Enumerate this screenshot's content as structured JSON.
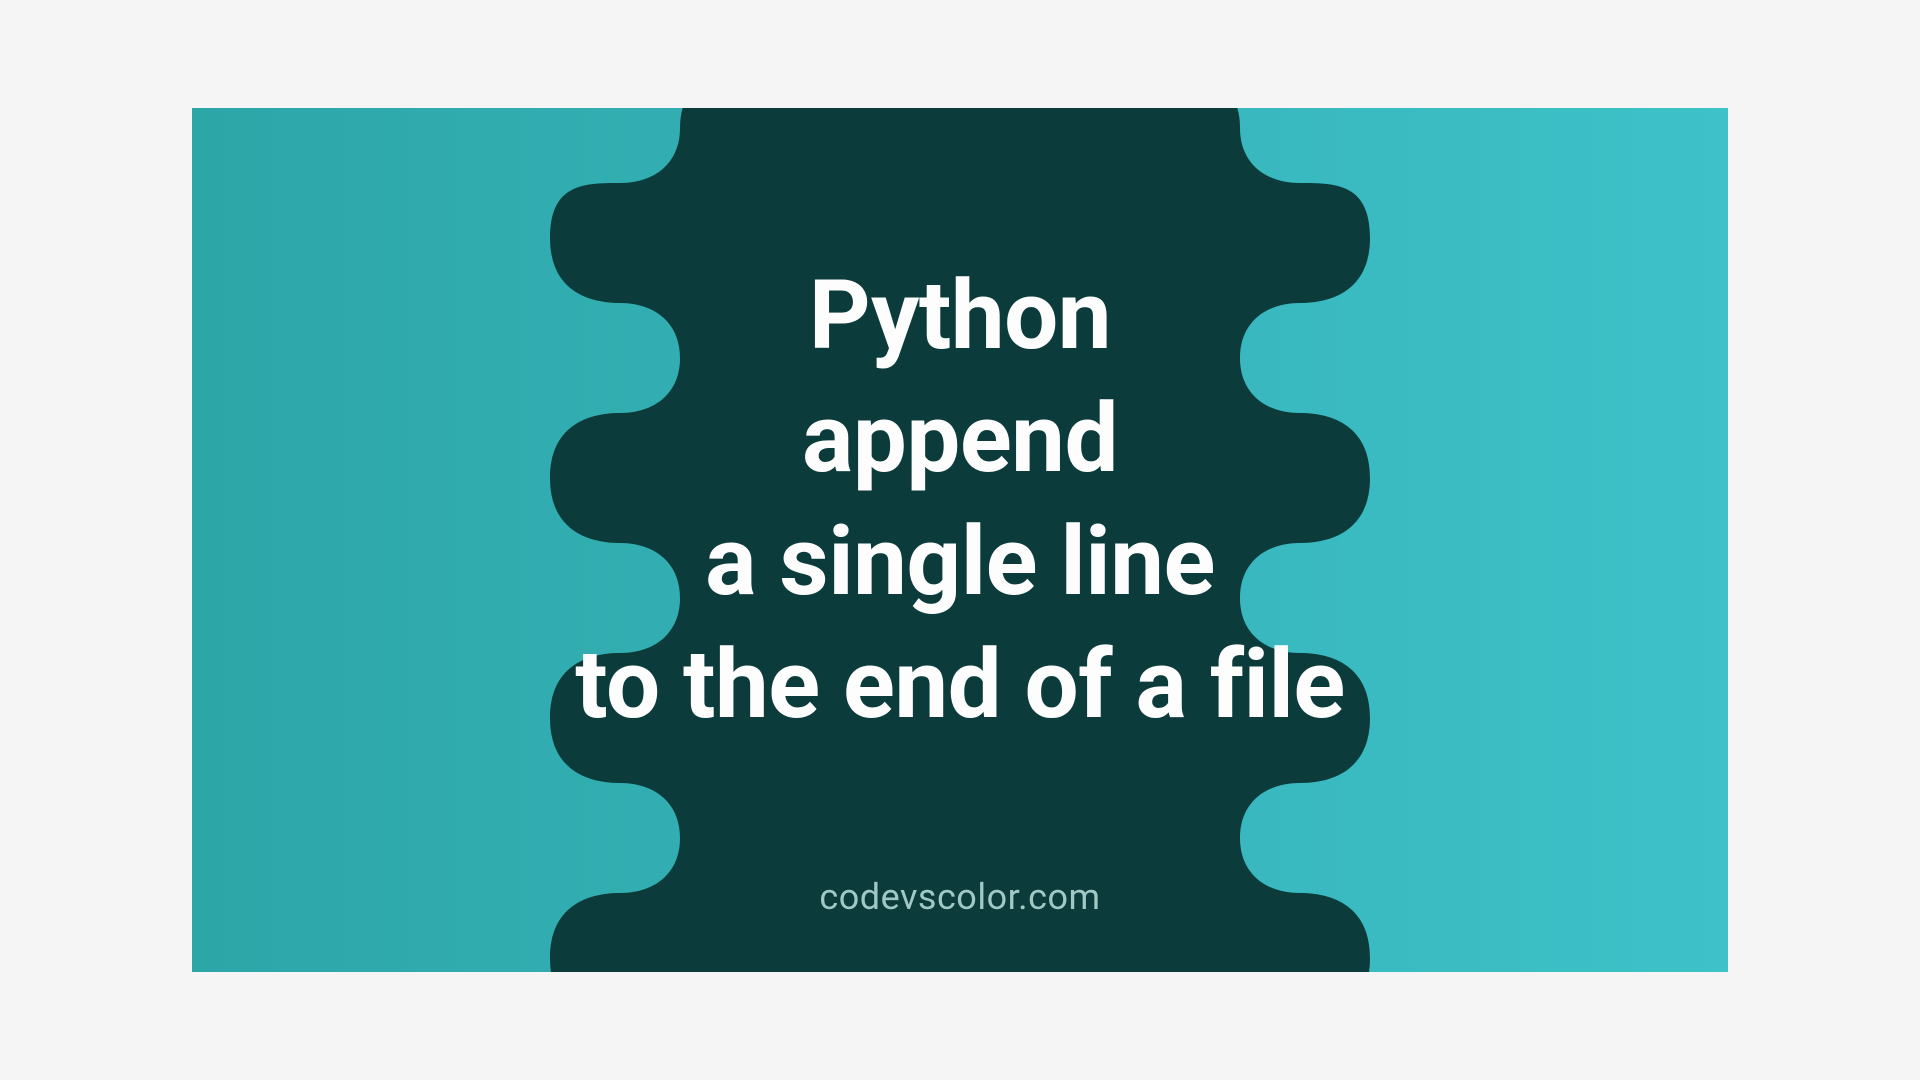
{
  "title": {
    "line1": "Python",
    "line2": "append",
    "line3": "a single line",
    "line4": "to the end of a file"
  },
  "watermark": "codevscolor.com",
  "colors": {
    "blob": "#0c3b3b",
    "bg_left": "#2da6a8",
    "bg_right": "#3ec1c9",
    "text": "#fdfdfd",
    "watermark": "#a0c8c5"
  }
}
